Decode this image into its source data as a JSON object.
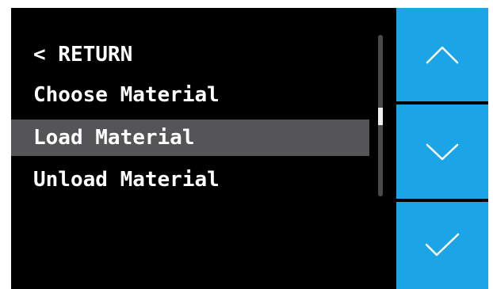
{
  "menu": {
    "items": [
      {
        "label": "< RETURN",
        "selected": false
      },
      {
        "label": "Choose Material",
        "selected": false
      },
      {
        "label": "Load Material",
        "selected": true
      },
      {
        "label": "Unload Material",
        "selected": false
      }
    ]
  },
  "side_buttons": [
    {
      "icon": "chevron-up-icon"
    },
    {
      "icon": "chevron-down-icon"
    },
    {
      "icon": "checkmark-icon"
    }
  ],
  "colors": {
    "background": "#000000",
    "selection": "#555456",
    "accent": "#1ba4e6",
    "text": "#ffffff"
  }
}
